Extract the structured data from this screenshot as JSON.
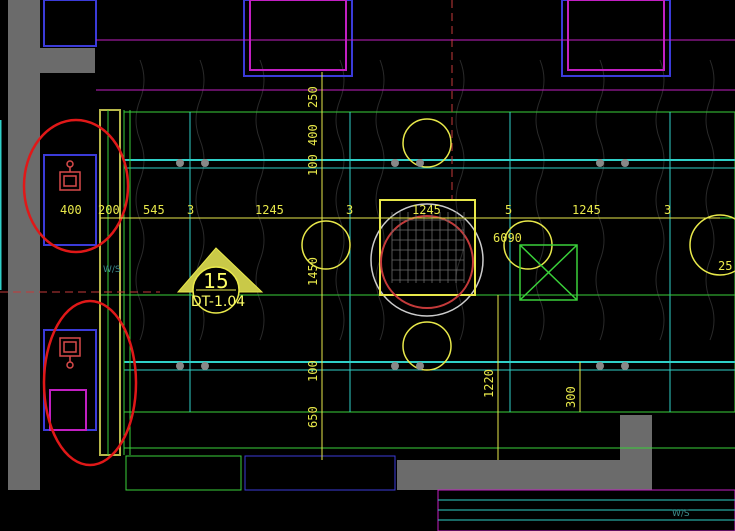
{
  "drawing": {
    "dimensions_horizontal": [
      "400",
      "200",
      "545",
      "3",
      "1245",
      "3",
      "1245",
      "5",
      "6090",
      "1245",
      "3",
      "25"
    ],
    "dimensions_vertical": [
      "250",
      "400",
      "100",
      "1450",
      "100",
      "650",
      "1220",
      "300"
    ],
    "section_tag": {
      "number": "15",
      "sheet": "DT-1.04"
    },
    "small_notes": [
      "W/S",
      "W/S"
    ],
    "colors": {
      "background": "#000000",
      "wall_fill": "#6b6b6b",
      "dimension": "#e8e84a",
      "cyan_line": "#2fd0c8",
      "green_line": "#3ad03a",
      "magenta_line": "#c21fc2",
      "blue_line": "#3b3bd9",
      "red_cloud": "#e01818",
      "red_fixture": "#c43a3a"
    }
  }
}
